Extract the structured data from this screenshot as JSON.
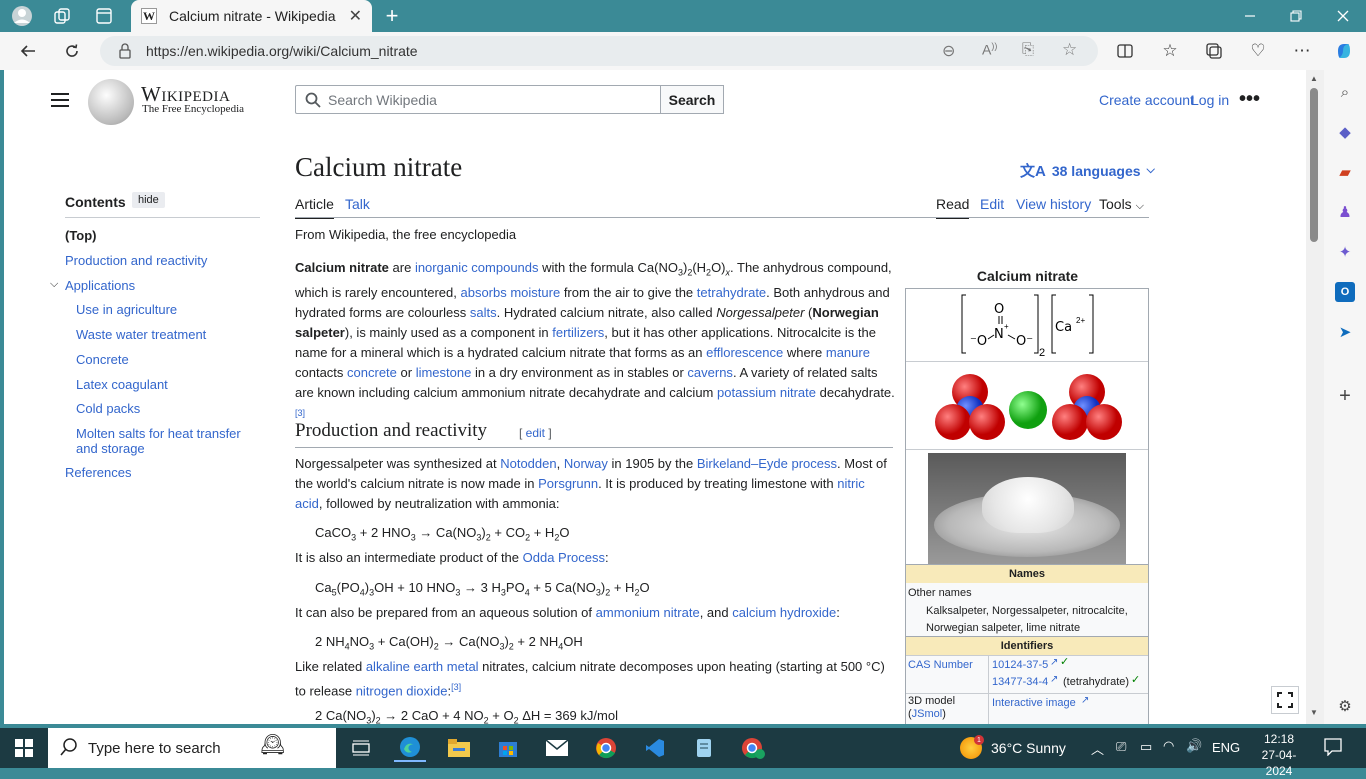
{
  "browser": {
    "tab_title": "Calcium nitrate - Wikipedia",
    "tab_favicon": "W",
    "url": "https://en.wikipedia.org/wiki/Calcium_nitrate"
  },
  "wiki": {
    "logo_title": "Wikipedia",
    "logo_subtitle": "The Free Encyclopedia",
    "search_placeholder": "Search Wikipedia",
    "search_button": "Search",
    "create_account": "Create account",
    "log_in": "Log in",
    "page_title": "Calcium nitrate",
    "languages": "38 languages",
    "tabs": {
      "article": "Article",
      "talk": "Talk",
      "read": "Read",
      "edit": "Edit",
      "history": "View history",
      "tools": "Tools"
    },
    "from": "From Wikipedia, the free encyclopedia",
    "toc": {
      "heading": "Contents",
      "hide": "hide",
      "items": [
        "(Top)",
        "Production and reactivity",
        "Applications",
        "Use in agriculture",
        "Waste water treatment",
        "Concrete",
        "Latex coagulant",
        "Cold packs",
        "Molten salts for heat transfer and storage",
        "References"
      ]
    },
    "section1": "Production and reactivity",
    "edit_link": "edit",
    "ref3": "[3]"
  },
  "infobox": {
    "title": "Calcium nitrate",
    "names_header": "Names",
    "other_names_label": "Other names",
    "other_names": "Kalksalpeter, Norgessalpeter, nitrocalcite, Norwegian salpeter, lime nitrate",
    "identifiers_header": "Identifiers",
    "cas_label": "CAS Number",
    "cas1": "10124-37-5",
    "cas2": "13477-34-4",
    "cas2_note": "(tetrahydrate)",
    "model_label": "3D model",
    "jsmol": "JSmol",
    "interactive": "Interactive image"
  },
  "taskbar": {
    "search_placeholder": "Type here to search",
    "weather": "36°C  Sunny",
    "lang": "ENG",
    "time": "12:18",
    "date": "27-04-2024",
    "weather_badge": "1"
  },
  "colors": {
    "accent": "#3b8a96",
    "link": "#3366cc",
    "infobox_header": "#f8eaba"
  }
}
